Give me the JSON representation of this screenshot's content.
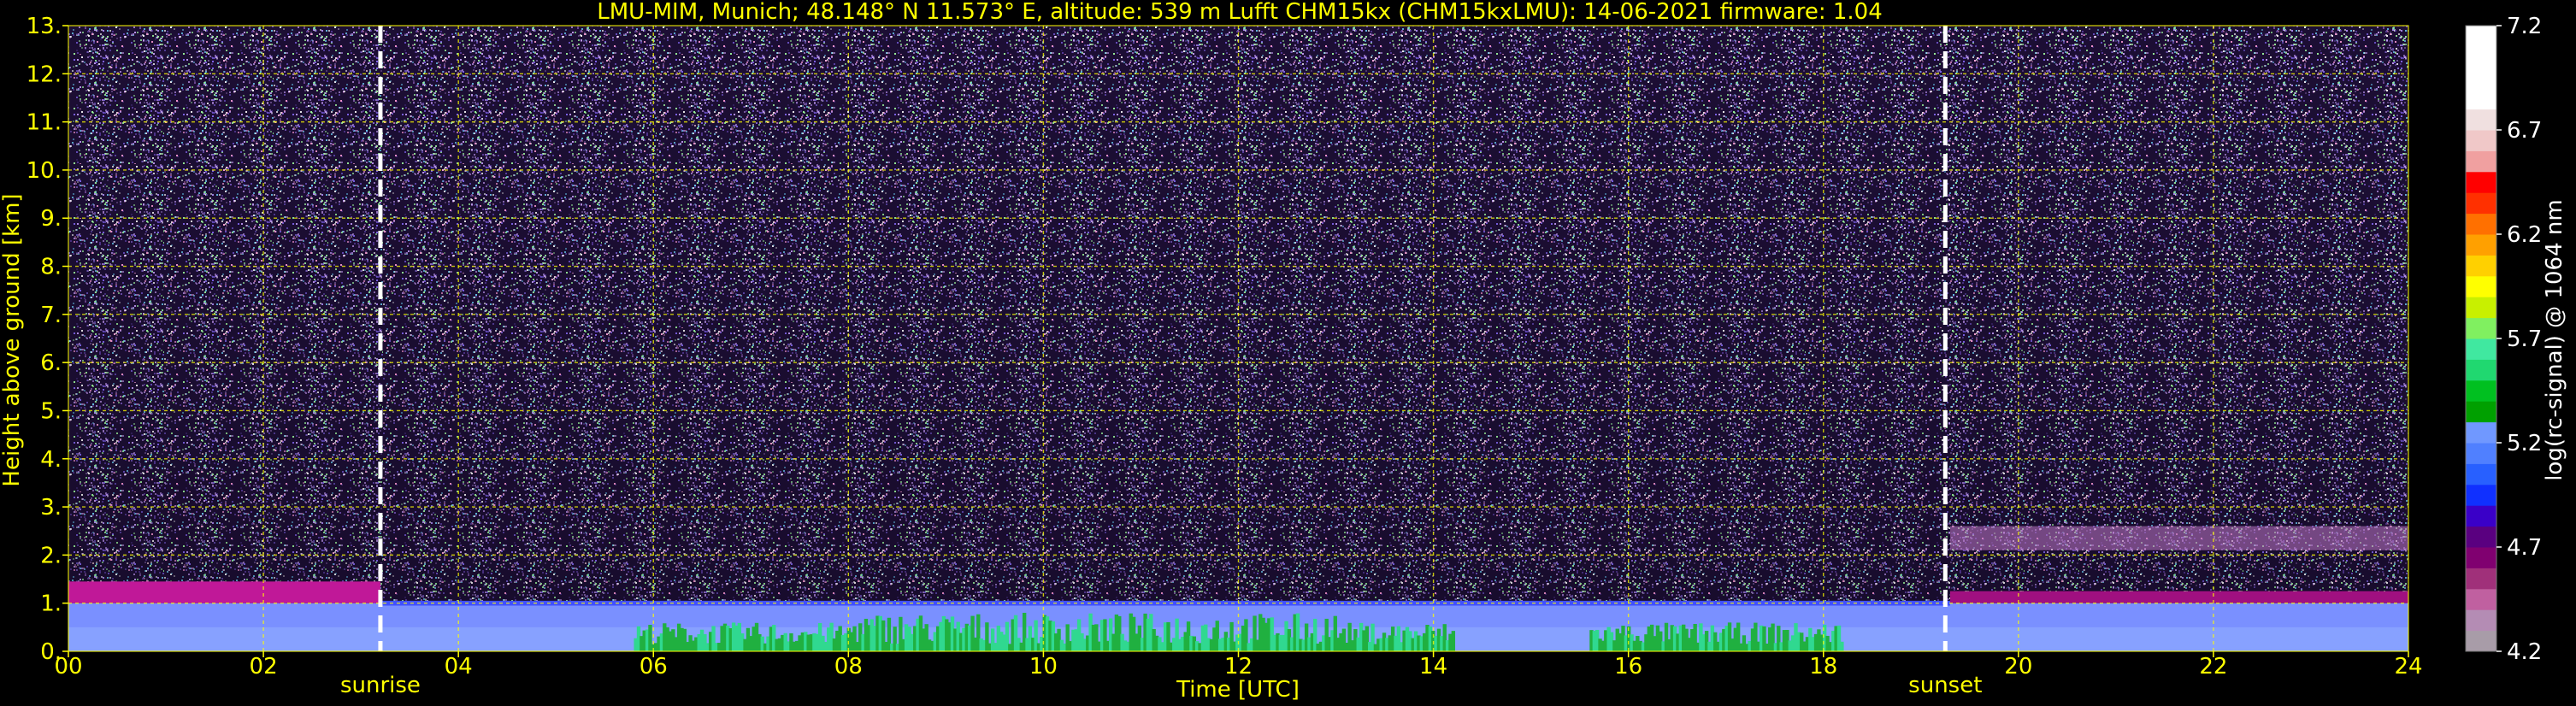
{
  "chart_data": {
    "type": "heatmap",
    "title": "LMU-MIM, Munich; 48.148° N 11.573° E, altitude: 539 m    Lufft CHM15kx (CHM15kxLMU): 14-06-2021    firmware: 1.04",
    "xlabel": "Time [UTC]",
    "ylabel": "Height above ground [km]",
    "xlim": [
      0,
      24
    ],
    "ylim": [
      0,
      13
    ],
    "x_ticks": [
      "00",
      "02",
      "04",
      "06",
      "08",
      "10",
      "12",
      "14",
      "16",
      "18",
      "20",
      "22",
      "24"
    ],
    "x_tick_values": [
      0,
      2,
      4,
      6,
      8,
      10,
      12,
      14,
      16,
      18,
      20,
      22,
      24
    ],
    "y_ticks": [
      "0.",
      "1.",
      "2.",
      "3.",
      "4.",
      "5.",
      "6.",
      "7.",
      "8.",
      "9.",
      "10.",
      "11.",
      "12.",
      "13."
    ],
    "y_tick_values": [
      0,
      1,
      2,
      3,
      4,
      5,
      6,
      7,
      8,
      9,
      10,
      11,
      12,
      13
    ],
    "grid": true,
    "grid_color": "#ffff00",
    "annotations": [
      {
        "label": "sunrise",
        "x": 3.2
      },
      {
        "label": "sunset",
        "x": 19.25
      }
    ],
    "colorbar": {
      "label": "log(rc-signal) @ 1064 nm",
      "range": [
        4.2,
        7.2
      ],
      "ticks": [
        "4.2",
        "4.7",
        "5.2",
        "5.7",
        "6.2",
        "6.7",
        "7.2"
      ],
      "tick_values": [
        4.2,
        4.7,
        5.2,
        5.7,
        6.2,
        6.7,
        7.2
      ],
      "colors": [
        "#a89ca8",
        "#b48cb4",
        "#c060a0",
        "#a0307a",
        "#800070",
        "#5a0080",
        "#3a00c8",
        "#1030ff",
        "#2860ff",
        "#5080ff",
        "#7098ff",
        "#00a000",
        "#00c020",
        "#20d870",
        "#40e8a0",
        "#80f060",
        "#c8f000",
        "#ffff00",
        "#ffd000",
        "#ffa000",
        "#ff7000",
        "#ff3000",
        "#ff0000",
        "#f0a0a0",
        "#f0c8c8",
        "#f0e0e0",
        "#ffffff",
        "#ffffff",
        "#ffffff",
        "#ffffff"
      ]
    },
    "background_layers": [
      {
        "name": "noise",
        "y_range": [
          1.0,
          13.0
        ]
      },
      {
        "name": "boundary-layer",
        "y_range": [
          0.0,
          1.0
        ]
      }
    ]
  }
}
